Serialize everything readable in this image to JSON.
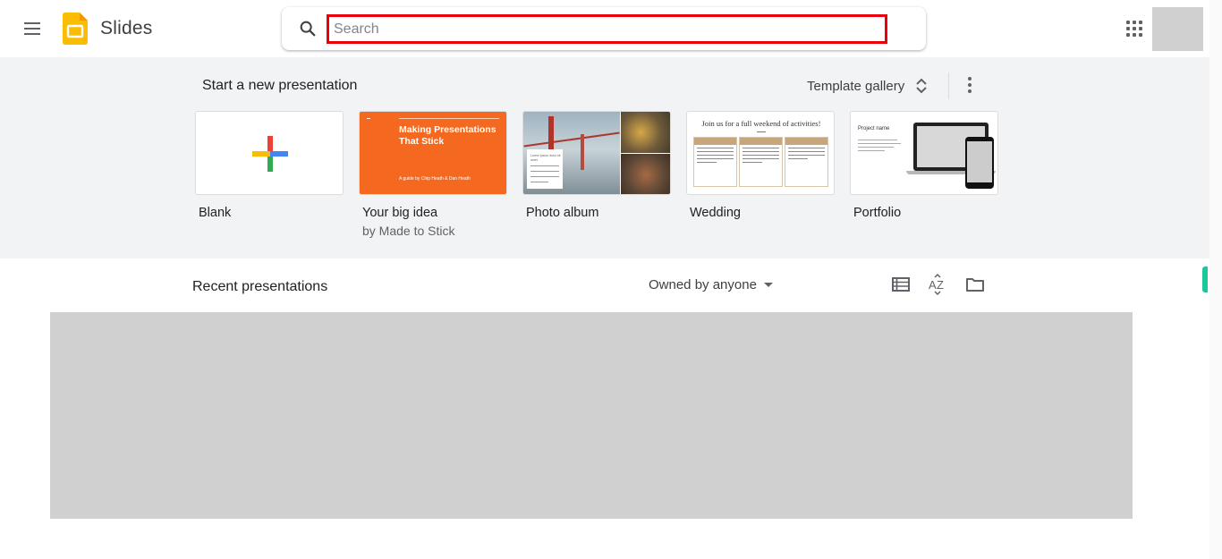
{
  "header": {
    "app_name": "Slides",
    "menu_icon": "hamburger-menu-icon",
    "logo_icon": "slides-logo-icon",
    "search_placeholder": "Search",
    "search_value": "",
    "apps_icon": "apps-grid-icon",
    "highlight_color": "#e8000b"
  },
  "templates": {
    "section_title": "Start a new presentation",
    "gallery_label": "Template gallery",
    "gallery_icon": "unfold-more-icon",
    "more_icon": "more-vert-icon",
    "items": [
      {
        "name": "Blank",
        "subtitle": ""
      },
      {
        "name": "Your big idea",
        "subtitle": "by Made to Stick",
        "thumb_title": "Making Presentations That Stick",
        "thumb_subtitle": "A guide by Chip Heath & Dan Heath",
        "thumb_color": "#f4691f"
      },
      {
        "name": "Photo album",
        "subtitle": "",
        "thumb_text": "Lorem ipsum dolor sit amet"
      },
      {
        "name": "Wedding",
        "subtitle": "",
        "thumb_title": "Join us for a full weekend of activities!"
      },
      {
        "name": "Portfolio",
        "subtitle": "",
        "thumb_title": "Project name"
      }
    ]
  },
  "recent": {
    "section_title": "Recent presentations",
    "owner_filter": "Owned by anyone",
    "list_view_icon": "list-view-icon",
    "sort_icon": "sort-az-icon",
    "folder_icon": "folder-icon"
  },
  "colors": {
    "band_background": "#f1f3f4",
    "accent_marker": "#1cc89a"
  }
}
